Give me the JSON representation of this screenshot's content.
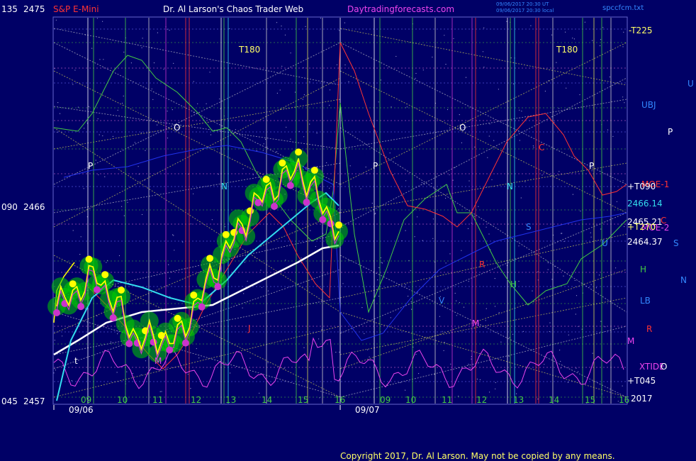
{
  "header": {
    "axis_top_left": "135",
    "price_top": "2475",
    "instrument": "S&P E-Mini",
    "site_title": "Dr. Al Larson's Chaos Trader Web",
    "site_url": "Daytradingforecasts.com",
    "timestamp_1": "09/06/2017 20:30 UT",
    "timestamp_2": "09/06/2017 20:30 local",
    "filename": "spccfcm.txt"
  },
  "left_axis": {
    "mid_angle": "090",
    "mid_price": "2466",
    "bottom_angle": "045",
    "bottom_price": "2457"
  },
  "right_labels": {
    "t225": "-T225",
    "ubj": "UBJ",
    "u_far": "U",
    "p_far": "P",
    "moe1": "MOE-1",
    "t090": "+T090",
    "price_2466_14": "2466.14",
    "c_label": "C",
    "moe2": "MOE-2",
    "price_2465_21": "2465.21",
    "t270": "+T270",
    "price_2464_37": "2464.37",
    "s_far": "S",
    "h_label": "H",
    "n_far": "N",
    "lb_label": "LB",
    "r_label": "R",
    "m_label": "M",
    "xtide": "XTIDE",
    "o_label": "O",
    "t045": "+T045",
    "year": "2017"
  },
  "x_axis": {
    "hours_day1": [
      "09",
      "10",
      "11",
      "12",
      "13",
      "14",
      "15",
      "16"
    ],
    "hours_day2": [
      "09",
      "10",
      "11",
      "12",
      "13",
      "14",
      "15",
      "16"
    ],
    "date1": "09/06",
    "date2": "09/07"
  },
  "annotations": {
    "t180_a": "T180",
    "t180_b": "T180",
    "o_a": "O",
    "o_b": "O",
    "p_a": "P",
    "p_b": "P",
    "p_c": "P",
    "n_a": "N",
    "n_b": "N",
    "s_a": "S",
    "c_a": "C",
    "r_a": "R",
    "m_a": "M",
    "h_a": "H",
    "u_a": "U",
    "v_a": "V",
    "t_a": "t",
    "m_b": "M",
    "j_a": "J"
  },
  "footer": {
    "copyright": "Copyright 2017, Dr. Al Larson. May not be copied by any means."
  },
  "colors": {
    "background": "#000066",
    "grid": "#8888ff",
    "price": "#ffff00",
    "glow": "#00cc00",
    "dots_up": "#ffff00",
    "dots_down": "#cc33cc",
    "ema_fast": "#33ddee",
    "ema_slow": "#ffffff",
    "red_line": "#ff3333",
    "green_line": "#44cc44",
    "magenta_line": "#ee44ee",
    "blue_line": "#2233ee"
  },
  "chart_data": {
    "type": "line",
    "title": "S&P E-Mini",
    "ylim": [
      2457,
      2475
    ],
    "x": [
      "09/06 09",
      "09/06 10",
      "09/06 11",
      "09/06 12",
      "09/06 13",
      "09/06 14",
      "09/06 15",
      "09/06 16"
    ],
    "series": [
      {
        "name": "S&P E-Mini",
        "values": [
          2461.5,
          2463.0,
          2460.0,
          2460.0,
          2463.5,
          2466.5,
          2468.0,
          2465.0
        ]
      }
    ],
    "levels": [
      2466.14,
      2465.21,
      2464.37
    ]
  }
}
